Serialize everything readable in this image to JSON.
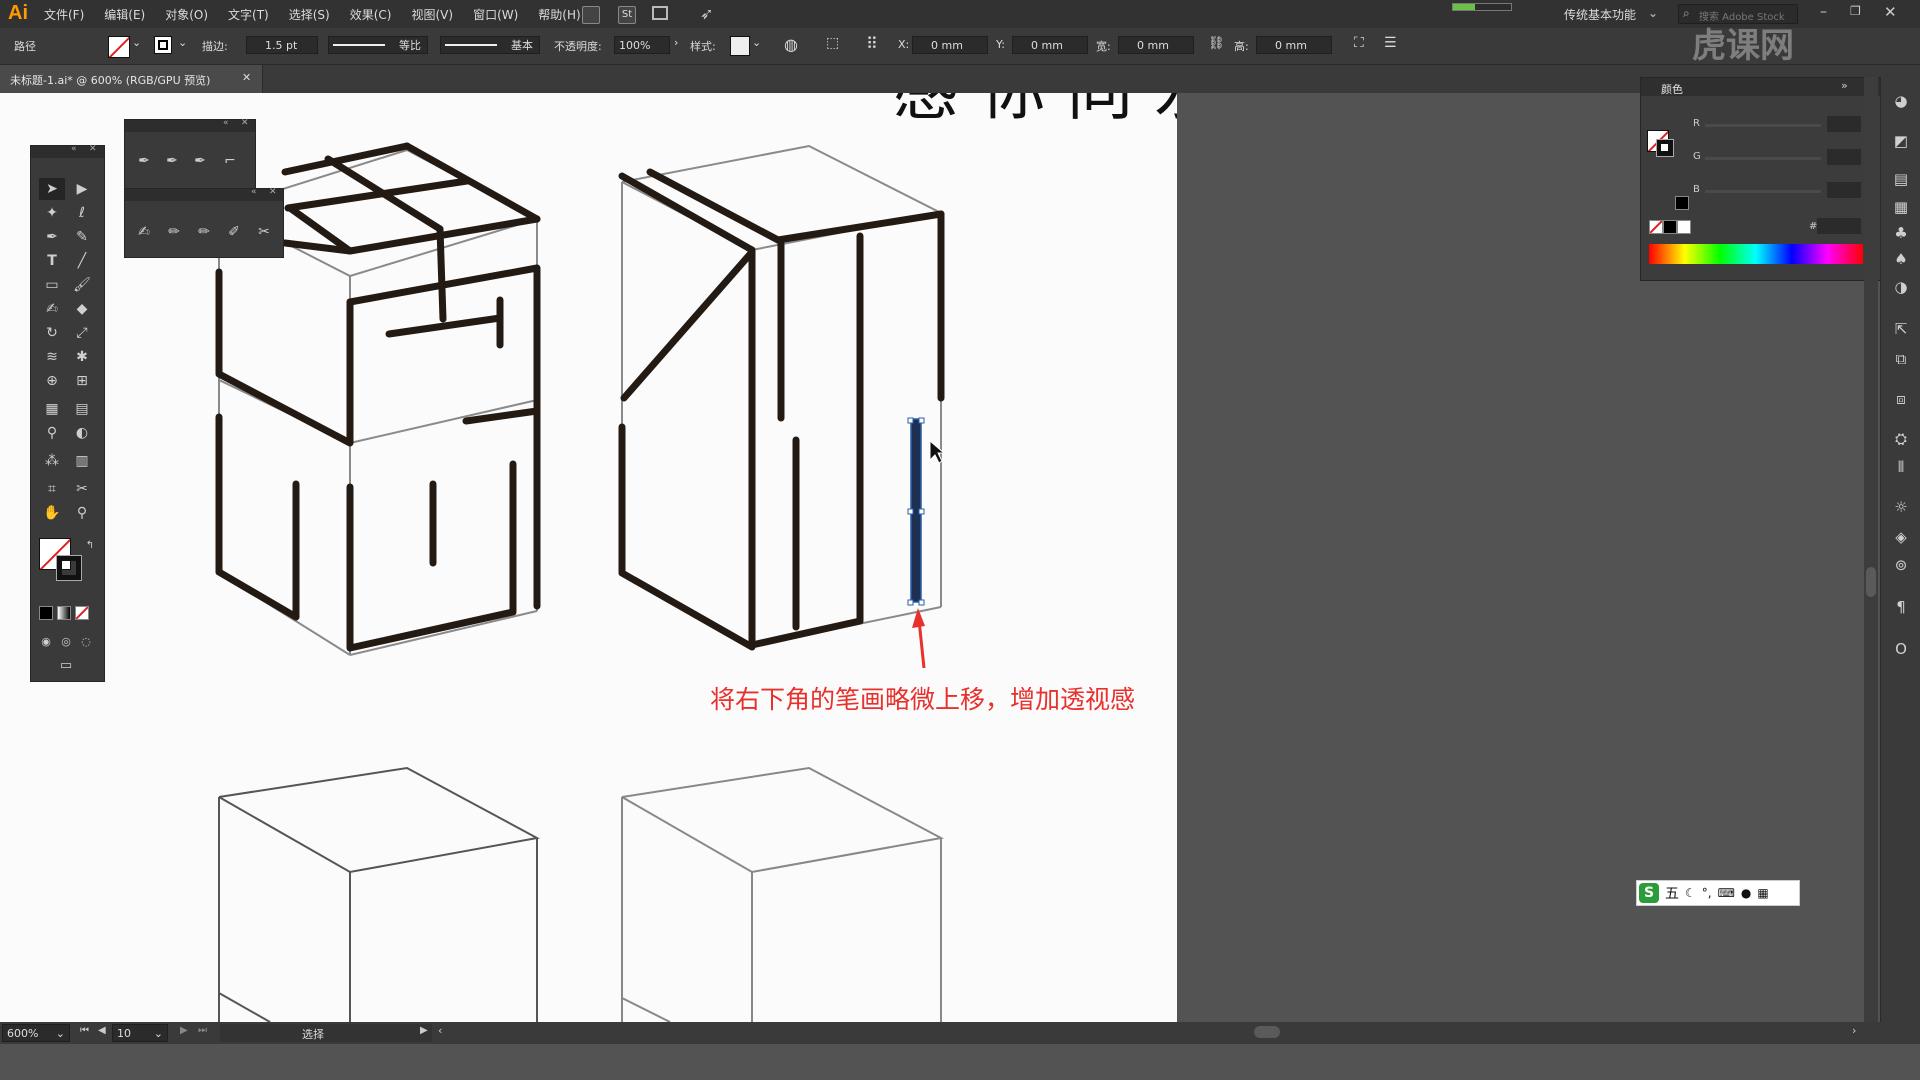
{
  "app": {
    "logo": "Ai"
  },
  "menu": {
    "items": [
      "文件(F)",
      "编辑(E)",
      "对象(O)",
      "文字(T)",
      "选择(S)",
      "效果(C)",
      "视图(V)",
      "窗口(W)",
      "帮助(H)"
    ],
    "st_label": "St",
    "workspace": "传统基本功能",
    "search_placeholder": "搜索 Adobe Stock"
  },
  "control": {
    "selection_type": "路径",
    "stroke_label": "描边:",
    "stroke_value": "1.5 pt",
    "profile1": "等比",
    "profile2": "基本",
    "opacity_label": "不透明度:",
    "opacity_value": "100%",
    "style_label": "样式:",
    "x_label": "X:",
    "x_value": "0 mm",
    "y_label": "Y:",
    "y_value": "0 mm",
    "w_label": "宽:",
    "w_value": "0 mm",
    "h_label": "高:",
    "h_value": "0 mm"
  },
  "document": {
    "tab_title": "未标题-1.ai* @ 600% (RGB/GPU 预览)"
  },
  "canvas": {
    "top_text": "感 你 同 永",
    "annotation": "将右下角的笔画略微上移，增加透视感",
    "annotation_color": "#e8302c"
  },
  "color_panel": {
    "title": "颜色",
    "channels": [
      "R",
      "G",
      "B"
    ],
    "hex_label": "#"
  },
  "ime": {
    "logo": "S",
    "mode": "五",
    "icons": [
      "moon-icon",
      "punct-icon",
      "keyboard-icon",
      "user-icon",
      "grid-icon"
    ]
  },
  "status": {
    "zoom": "600%",
    "page": "10",
    "mode": "选择"
  },
  "watermark": "虎课网",
  "colors": {
    "accent": "#ff9a00",
    "selection": "#2b5ea8",
    "stroke": "#241a14"
  }
}
